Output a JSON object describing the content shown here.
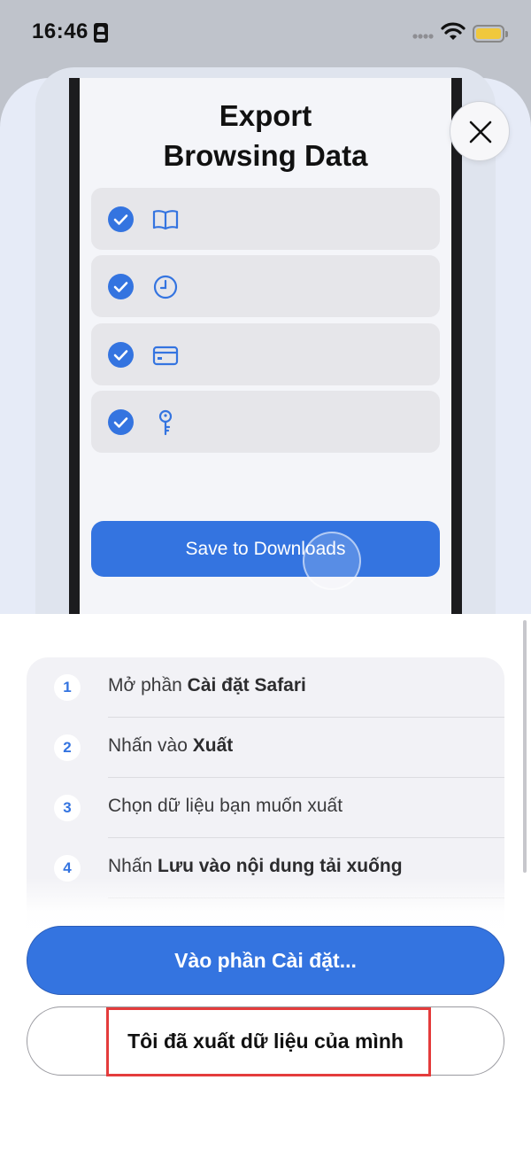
{
  "status_bar": {
    "time": "16:46",
    "battery_color": "#f0c83c"
  },
  "illustration": {
    "title_line1": "Export",
    "title_line2": "Browsing Data",
    "options": [
      {
        "icon": "book-icon",
        "checked": true
      },
      {
        "icon": "clock-icon",
        "checked": true
      },
      {
        "icon": "credit-card-icon",
        "checked": true
      },
      {
        "icon": "key-icon",
        "checked": true
      }
    ],
    "save_button_label": "Save to Downloads"
  },
  "steps": [
    {
      "number": "1",
      "text_plain": "Mở phần ",
      "text_bold": "Cài đặt Safari"
    },
    {
      "number": "2",
      "text_plain": "Nhấn vào ",
      "text_bold": "Xuất"
    },
    {
      "number": "3",
      "text_plain": "Chọn dữ liệu bạn muốn xuất",
      "text_bold": ""
    },
    {
      "number": "4",
      "text_plain": "Nhấn ",
      "text_bold": "Lưu vào nội dung tải xuống"
    }
  ],
  "buttons": {
    "primary_label": "Vào phần Cài đặt...",
    "secondary_label": "Tôi đã xuất dữ liệu của mình"
  },
  "colors": {
    "accent": "#3474e0",
    "highlight": "#e43c3c"
  }
}
